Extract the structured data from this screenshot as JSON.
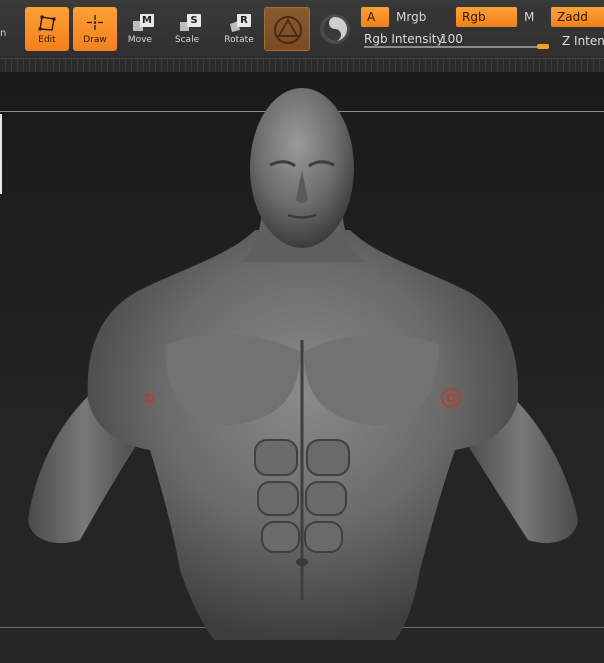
{
  "toolbar": {
    "edge_label": "n",
    "edit": {
      "label": "Edit",
      "active": true
    },
    "draw": {
      "label": "Draw",
      "active": true
    },
    "move": {
      "label": "Move",
      "key": "M"
    },
    "scale": {
      "label": "Scale",
      "key": "S"
    },
    "rotate": {
      "label": "Rotate",
      "key": "R"
    },
    "gizmo": {
      "icon": "transpose-gizmo-icon",
      "active": true
    },
    "solo": {
      "icon": "solo-mode-icon"
    }
  },
  "modes": {
    "a": {
      "label": "A",
      "on": true
    },
    "mrgb": {
      "label": "Mrgb",
      "on": false
    },
    "rgb": {
      "label": "Rgb",
      "on": true
    },
    "m": {
      "label": "M",
      "on": false
    },
    "zadd": {
      "label": "Zadd",
      "on": true
    }
  },
  "rgb_intensity": {
    "label": "Rgb Intensity",
    "value": "100",
    "fraction": 1.0
  },
  "z_intensity": {
    "label": "Z Intens"
  },
  "colors": {
    "accent": "#f7901e",
    "background": "#1b1b1b",
    "marker": "#c0392b"
  }
}
